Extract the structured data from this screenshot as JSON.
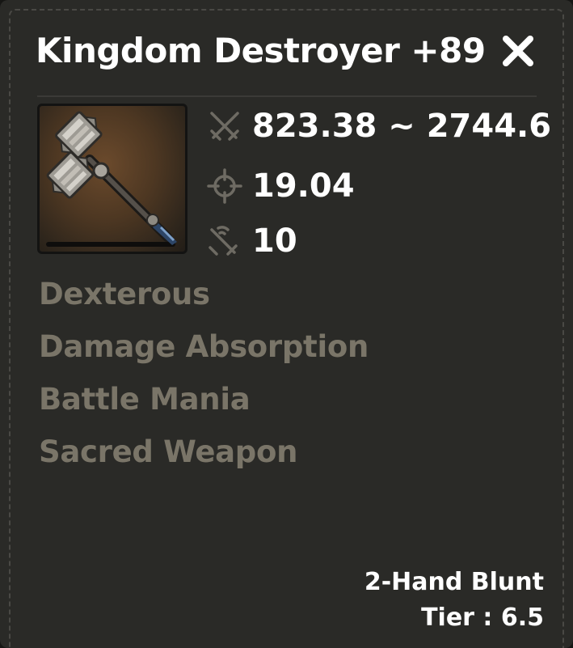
{
  "item": {
    "name": "Kingdom Destroyer +89",
    "icon": "two-hand-mace-icon",
    "stats": [
      {
        "icon": "crossed-swords-icon",
        "value": "823.38 ~ 2744.6"
      },
      {
        "icon": "crosshair-icon",
        "value": "19.04"
      },
      {
        "icon": "sword-signal-icon",
        "value": "10"
      }
    ],
    "perks": [
      "Dexterous",
      "Damage Absorption",
      "Battle Mania",
      "Sacred Weapon"
    ],
    "type": "2-Hand Blunt",
    "tier": "Tier : 6.5"
  },
  "colors": {
    "panel": "#2a2a27",
    "title": "#ffffff",
    "perk": "#7a7568",
    "stat_icon": "#6e6b63"
  }
}
